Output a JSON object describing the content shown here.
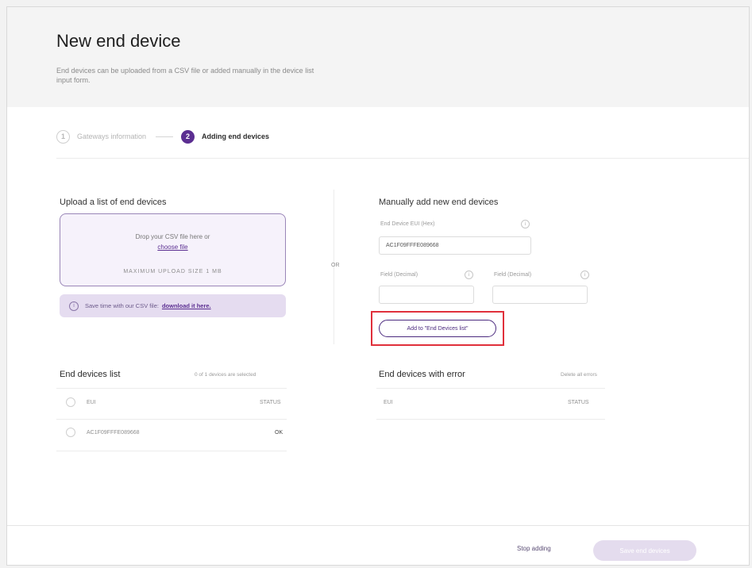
{
  "header": {
    "title": "New end device",
    "subtitle": "End devices can be uploaded from a CSV file or added manually in the device list input form."
  },
  "stepper": {
    "steps": [
      {
        "number": "1",
        "label": "Gateways information",
        "state": "done"
      },
      {
        "number": "2",
        "label": "Adding end devices",
        "state": "active"
      }
    ]
  },
  "upload": {
    "section_title": "Upload a list of end devices",
    "drop_text": "Drop your CSV file here or",
    "browse_link": "choose file",
    "formats": "MAXIMUM UPLOAD SIZE 1 MB",
    "hint_text": "Save time with our CSV file:",
    "hint_link": "download it here."
  },
  "divider": {
    "or_label": "OR"
  },
  "manual": {
    "section_title": "Manually add new end devices",
    "euid_label": "End Device EUI (Hex)",
    "euid_value": "AC1F09FFFE089668",
    "field2_label": "Field (Decimal)",
    "field2_value": "",
    "field3_label": "Field (Decimal)",
    "field3_value": "",
    "add_button": "Add to \"End Devices list\""
  },
  "end_devices_list": {
    "title": "End devices list",
    "meta": "0 of 1 devices are selected",
    "header_col1": "EUI",
    "header_col2": "STATUS",
    "rows": [
      {
        "eui": "AC1F09FFFE089668",
        "status": "OK"
      }
    ]
  },
  "errors_list": {
    "title": "End devices with error",
    "meta": "Delete all errors",
    "header_col1": "EUI",
    "header_col2": "STATUS"
  },
  "footer": {
    "stop_label": "Stop adding",
    "primary_label": "Save end devices"
  },
  "colors": {
    "brand_purple": "#5b2e91",
    "highlight_red": "#e0303b",
    "primary_disabled": "#e4dcee"
  }
}
